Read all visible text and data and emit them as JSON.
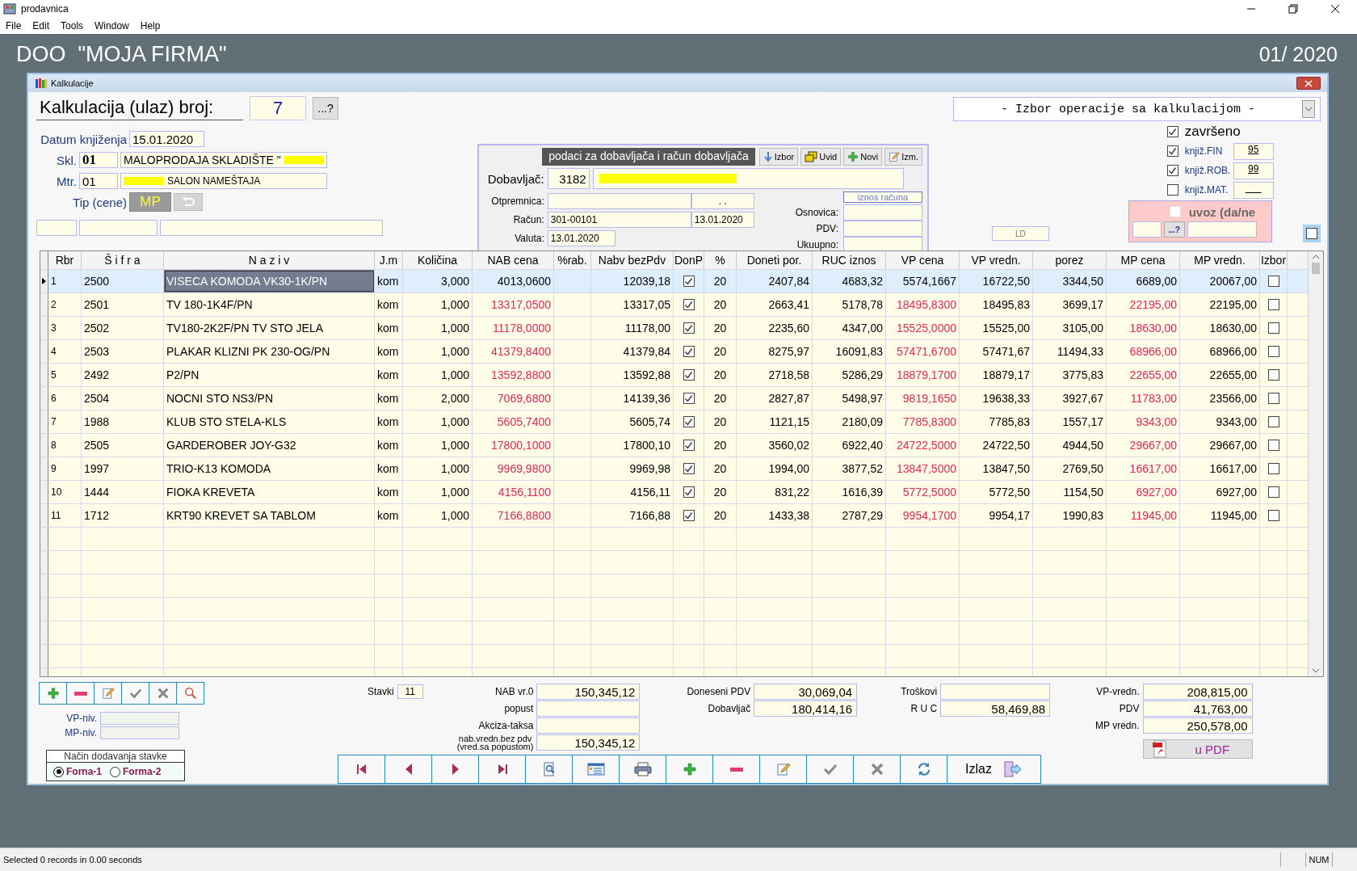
{
  "app": {
    "title": "prodavnica",
    "menu": [
      "File",
      "Edit",
      "Tools",
      "Window",
      "Help"
    ],
    "company": "DOO  \"MOJA FIRMA\"",
    "period": "01/ 2020"
  },
  "window": {
    "title": "Kalkulacije"
  },
  "header": {
    "label": "Kalkulacija (ulaz) broj:",
    "number": "7",
    "lookup_button": "...?"
  },
  "form": {
    "datum_label": "Datum knjiženja",
    "datum": "15.01.2020",
    "skl_label": "Skl.",
    "skl_code": "01",
    "skl_name": "MALOPRODAJA SKLADIŠTE \"",
    "mtr_label": "Mtr.",
    "mtr_code": "01",
    "mtr_name": "SALON NAMEŠTAJA",
    "tip_label": "Tip (cene)",
    "tip": "MP"
  },
  "supplier": {
    "title": "podaci za dobavljača i račun dobavljača",
    "buttons": [
      {
        "label": "Izbor",
        "kind": "down"
      },
      {
        "label": "Uvid",
        "kind": "folders"
      },
      {
        "label": "Novi",
        "kind": "add"
      },
      {
        "label": "Izm.",
        "kind": "edit"
      }
    ],
    "dobavljac_label": "Dobavljač:",
    "dobavljac_code": "3182",
    "otpremnica_label": "Otpremnica:",
    "otpremnica_date": ". .",
    "racun_label": "Račun:",
    "racun": "301-00101",
    "racun_date": "13.01.2020",
    "valuta_label": "Valuta:",
    "valuta": "13.01.2020",
    "iznos_title": "iznos računa",
    "iznos_labels": [
      "Osnovica:",
      "PDV:",
      "Ukuupno:"
    ]
  },
  "operation_select": "- Izbor operacije sa kalkulacijom -",
  "flags": {
    "zavrseno": {
      "label": "završeno",
      "checked": true
    },
    "postings": [
      {
        "label": "knjiž.FIN",
        "checked": true,
        "value": "95"
      },
      {
        "label": "knjiž.ROB.",
        "checked": true,
        "value": "99"
      },
      {
        "label": "knjiž.MAT.",
        "checked": false
      }
    ],
    "uvoz": {
      "label": "uvoz (da/ne",
      "checked": false,
      "lookup_button": "...?"
    },
    "ld": "LD",
    "extra_checked": false
  },
  "table": {
    "columns": [
      "Rbr",
      "Š i f r a",
      "N a z i v",
      "J.m",
      "Količina",
      "NAB cena",
      "%rab.",
      "Nabv bezPdv",
      "DonP",
      "%",
      "Doneti por.",
      "RUC iznos",
      "VP cena",
      "VP vredn.",
      "porez",
      "MP cena",
      "MP vredn.",
      "Izbor"
    ],
    "rows": [
      {
        "selected": true,
        "changed": false,
        "rbr": "1",
        "sifra": "2500",
        "naziv": "VISECA KOMODA VK30-1K/PN",
        "jm": "kom",
        "kolicina": "3,000",
        "nab_cena": "4013,0600",
        "nabv": "12039,18",
        "donp": true,
        "pct": "20",
        "doneti": "2407,84",
        "ruc": "4683,32",
        "vp_cena": "5574,1667",
        "vp_vredn": "16722,50",
        "porez": "3344,50",
        "mp_cena": "6689,00",
        "mp_vredn": "20067,00",
        "izbor": false
      },
      {
        "selected": false,
        "changed": true,
        "rbr": "2",
        "sifra": "2501",
        "naziv": "TV 180-1K4F/PN",
        "jm": "kom",
        "kolicina": "1,000",
        "nab_cena": "13317,0500",
        "nabv": "13317,05",
        "donp": true,
        "pct": "20",
        "doneti": "2663,41",
        "ruc": "5178,78",
        "vp_cena": "18495,8300",
        "vp_vredn": "18495,83",
        "porez": "3699,17",
        "mp_cena": "22195,00",
        "mp_vredn": "22195,00",
        "izbor": false
      },
      {
        "selected": false,
        "changed": true,
        "rbr": "3",
        "sifra": "2502",
        "naziv": "TV180-2K2F/PN TV STO JELA",
        "jm": "kom",
        "kolicina": "1,000",
        "nab_cena": "11178,0000",
        "nabv": "11178,00",
        "donp": true,
        "pct": "20",
        "doneti": "2235,60",
        "ruc": "4347,00",
        "vp_cena": "15525,0000",
        "vp_vredn": "15525,00",
        "porez": "3105,00",
        "mp_cena": "18630,00",
        "mp_vredn": "18630,00",
        "izbor": false
      },
      {
        "selected": false,
        "changed": true,
        "rbr": "4",
        "sifra": "2503",
        "naziv": "PLAKAR KLIZNI PK 230-OG/PN",
        "jm": "kom",
        "kolicina": "1,000",
        "nab_cena": "41379,8400",
        "nabv": "41379,84",
        "donp": true,
        "pct": "20",
        "doneti": "8275,97",
        "ruc": "16091,83",
        "vp_cena": "57471,6700",
        "vp_vredn": "57471,67",
        "porez": "11494,33",
        "mp_cena": "68966,00",
        "mp_vredn": "68966,00",
        "izbor": false
      },
      {
        "selected": false,
        "changed": true,
        "rbr": "5",
        "sifra": "2492",
        "naziv": "P2/PN",
        "jm": "kom",
        "kolicina": "1,000",
        "nab_cena": "13592,8800",
        "nabv": "13592,88",
        "donp": true,
        "pct": "20",
        "doneti": "2718,58",
        "ruc": "5286,29",
        "vp_cena": "18879,1700",
        "vp_vredn": "18879,17",
        "porez": "3775,83",
        "mp_cena": "22655,00",
        "mp_vredn": "22655,00",
        "izbor": false
      },
      {
        "selected": false,
        "changed": true,
        "rbr": "6",
        "sifra": "2504",
        "naziv": "NOCNI STO NS3/PN",
        "jm": "kom",
        "kolicina": "2,000",
        "nab_cena": "7069,6800",
        "nabv": "14139,36",
        "donp": true,
        "pct": "20",
        "doneti": "2827,87",
        "ruc": "5498,97",
        "vp_cena": "9819,1650",
        "vp_vredn": "19638,33",
        "porez": "3927,67",
        "mp_cena": "11783,00",
        "mp_vredn": "23566,00",
        "izbor": false
      },
      {
        "selected": false,
        "changed": true,
        "rbr": "7",
        "sifra": "1988",
        "naziv": "KLUB STO STELA-KLS",
        "jm": "kom",
        "kolicina": "1,000",
        "nab_cena": "5605,7400",
        "nabv": "5605,74",
        "donp": true,
        "pct": "20",
        "doneti": "1121,15",
        "ruc": "2180,09",
        "vp_cena": "7785,8300",
        "vp_vredn": "7785,83",
        "porez": "1557,17",
        "mp_cena": "9343,00",
        "mp_vredn": "9343,00",
        "izbor": false
      },
      {
        "selected": false,
        "changed": true,
        "rbr": "8",
        "sifra": "2505",
        "naziv": "GARDEROBER JOY-G32",
        "jm": "kom",
        "kolicina": "1,000",
        "nab_cena": "17800,1000",
        "nabv": "17800,10",
        "donp": true,
        "pct": "20",
        "doneti": "3560,02",
        "ruc": "6922,40",
        "vp_cena": "24722,5000",
        "vp_vredn": "24722,50",
        "porez": "4944,50",
        "mp_cena": "29667,00",
        "mp_vredn": "29667,00",
        "izbor": false
      },
      {
        "selected": false,
        "changed": true,
        "rbr": "9",
        "sifra": "1997",
        "naziv": "TRIO-K13 KOMODA",
        "jm": "kom",
        "kolicina": "1,000",
        "nab_cena": "9969,9800",
        "nabv": "9969,98",
        "donp": true,
        "pct": "20",
        "doneti": "1994,00",
        "ruc": "3877,52",
        "vp_cena": "13847,5000",
        "vp_vredn": "13847,50",
        "porez": "2769,50",
        "mp_cena": "16617,00",
        "mp_vredn": "16617,00",
        "izbor": false
      },
      {
        "selected": false,
        "changed": true,
        "rbr": "10",
        "sifra": "1444",
        "naziv": "FIOKA KREVETA",
        "jm": "kom",
        "kolicina": "1,000",
        "nab_cena": "4156,1100",
        "nabv": "4156,11",
        "donp": true,
        "pct": "20",
        "doneti": "831,22",
        "ruc": "1616,39",
        "vp_cena": "5772,5000",
        "vp_vredn": "5772,50",
        "porez": "1154,50",
        "mp_cena": "6927,00",
        "mp_vredn": "6927,00",
        "izbor": false
      },
      {
        "selected": false,
        "changed": true,
        "rbr": "11",
        "sifra": "1712",
        "naziv": "KRT90 KREVET SA TABLOM",
        "jm": "kom",
        "kolicina": "1,000",
        "nab_cena": "7166,8800",
        "nabv": "7166,88",
        "donp": true,
        "pct": "20",
        "doneti": "1433,38",
        "ruc": "2787,29",
        "vp_cena": "9954,1700",
        "vp_vredn": "9954,17",
        "porez": "1990,83",
        "mp_cena": "11945,00",
        "mp_vredn": "11945,00",
        "izbor": false
      }
    ]
  },
  "row_tools": [
    {
      "kind": "add"
    },
    {
      "kind": "remove"
    },
    {
      "kind": "edit"
    },
    {
      "kind": "confirm"
    },
    {
      "kind": "cancel"
    },
    {
      "kind": "search"
    }
  ],
  "levels": [
    {
      "label": "VP-niv."
    },
    {
      "label": "MP-niv."
    }
  ],
  "add_mode": {
    "title": "Način dodavanja stavke",
    "options": [
      {
        "label": "Forna-1",
        "selected": true
      },
      {
        "label": "Forma-2",
        "selected": false
      }
    ]
  },
  "stavki": {
    "label": "Stavki",
    "value": "11"
  },
  "totals_nab": [
    {
      "label": "NAB vr.0",
      "value": "150,345,12"
    },
    {
      "label": "popust"
    },
    {
      "label": "Akciza-taksa"
    },
    {
      "label": "nab.vredn.bez pdv",
      "sublabel": "(vred.sa popustom)",
      "value": "150,345,12"
    }
  ],
  "totals_mid": [
    {
      "label": "Doneseni PDV",
      "value": "30,069,04"
    },
    {
      "label": "Dobavljač",
      "value": "180,414,16"
    }
  ],
  "totals_ruc": [
    {
      "label": "Troškovi"
    },
    {
      "label": "R U C",
      "value": "58,469,88"
    }
  ],
  "totals_right": [
    {
      "label": "VP-vredn.",
      "value": "208,815,00"
    },
    {
      "label": "PDV",
      "value": "41,763,00"
    },
    {
      "label": "MP vredn.",
      "value": "250,578,00"
    }
  ],
  "pdf_button": "u  PDF",
  "nav": [
    {
      "kind": "first"
    },
    {
      "kind": "prev"
    },
    {
      "kind": "next"
    },
    {
      "kind": "last"
    },
    {
      "kind": "preview"
    },
    {
      "kind": "list"
    },
    {
      "kind": "print"
    },
    {
      "kind": "add"
    },
    {
      "kind": "remove"
    },
    {
      "kind": "edit"
    },
    {
      "kind": "confirm"
    },
    {
      "kind": "cancel"
    },
    {
      "kind": "refresh"
    },
    {
      "kind": "exit",
      "label": "Izlaz"
    }
  ],
  "status_bar": {
    "text": "Selected 0 records in 0.00 seconds",
    "num": "NUM"
  }
}
